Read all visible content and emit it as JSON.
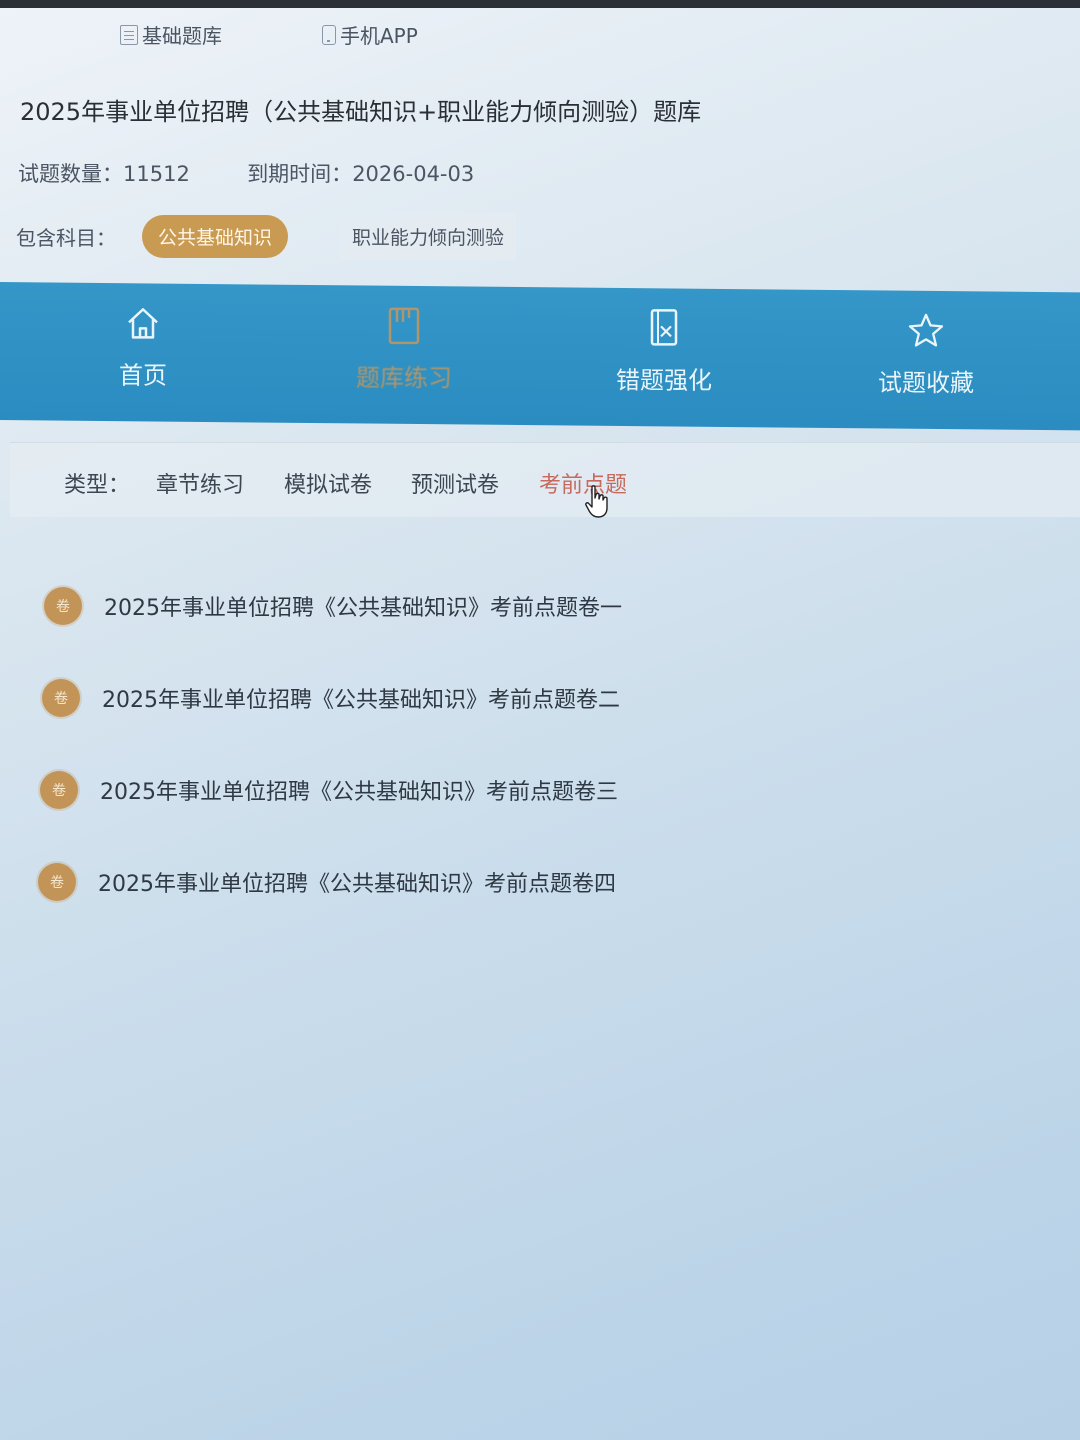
{
  "top_nav": {
    "items": [
      {
        "label": "基础题库",
        "icon": "document-icon"
      },
      {
        "label": "手机APP",
        "icon": "phone-icon"
      }
    ]
  },
  "bank": {
    "title": "2025年事业单位招聘（公共基础知识+职业能力倾向测验）题库",
    "question_count_label": "试题数量：",
    "question_count": "11512",
    "expiry_label": "到期时间：",
    "expiry": "2026-04-03",
    "subjects_label": "包含科目：",
    "subjects": [
      "公共基础知识",
      "职业能力倾向测验"
    ],
    "selected_subject": "公共基础知识"
  },
  "main_nav": {
    "accent": "#2b8fc3",
    "items": [
      {
        "label": "首页",
        "icon": "home-icon"
      },
      {
        "label": "题库练习",
        "icon": "book-icon",
        "active": true
      },
      {
        "label": "错题强化",
        "icon": "error-sheet-icon"
      },
      {
        "label": "试题收藏",
        "icon": "star-icon"
      }
    ]
  },
  "filter": {
    "label": "类型：",
    "options": [
      "章节练习",
      "模拟试卷",
      "预测试卷",
      "考前点题"
    ],
    "active": "考前点题"
  },
  "papers": {
    "badge": "卷",
    "badge_color": "#c39458",
    "items": [
      "2025年事业单位招聘《公共基础知识》考前点题卷一",
      "2025年事业单位招聘《公共基础知识》考前点题卷二",
      "2025年事业单位招聘《公共基础知识》考前点题卷三",
      "2025年事业单位招聘《公共基础知识》考前点题卷四"
    ]
  }
}
